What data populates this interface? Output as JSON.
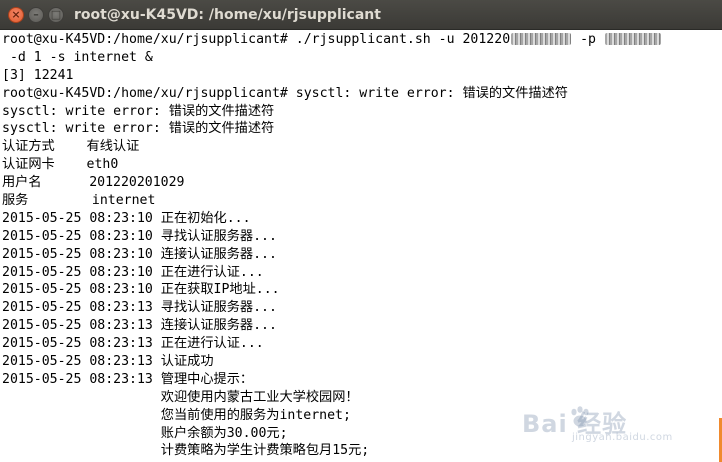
{
  "window": {
    "title": "root@xu-K45VD: /home/xu/rjsupplicant",
    "close_symbol": "×",
    "minimize_symbol": "–",
    "maximize_symbol": "□"
  },
  "terminal": {
    "cmd_prefix": "root@xu-K45VD:/home/xu/rjsupplicant# ./rjsupplicant.sh -u 201220",
    "cmd_p_flag": " -p ",
    "cmd_cont": " -d 1 -s internet &",
    "job": "[3] 12241",
    "prompt2": "root@xu-K45VD:/home/xu/rjsupplicant# sysctl: write error: 错误的文件描述符",
    "err1": "sysctl: write error: 错误的文件描述符",
    "err2": "sysctl: write error: 错误的文件描述符",
    "info": [
      "认证方式    有线认证",
      "认证网卡    eth0",
      "用户名      201220201029",
      "服务        internet"
    ],
    "log": [
      "2015-05-25 08:23:10 正在初始化...",
      "2015-05-25 08:23:10 寻找认证服务器...",
      "2015-05-25 08:23:10 连接认证服务器...",
      "2015-05-25 08:23:10 正在进行认证...",
      "2015-05-25 08:23:10 正在获取IP地址...",
      "2015-05-25 08:23:13 寻找认证服务器...",
      "2015-05-25 08:23:13 连接认证服务器...",
      "2015-05-25 08:23:13 正在进行认证...",
      "2015-05-25 08:23:13 认证成功",
      "2015-05-25 08:23:13 管理中心提示："
    ],
    "notice": [
      "                    欢迎使用内蒙古工业大学校园网！",
      "                    您当前使用的服务为internet;",
      "                    账户余额为30.00元;",
      "                    计费策略为学生计费策略包月15元;"
    ]
  },
  "watermark": {
    "brand": "Bai  经验",
    "url": "jingyan.baidu.com"
  }
}
